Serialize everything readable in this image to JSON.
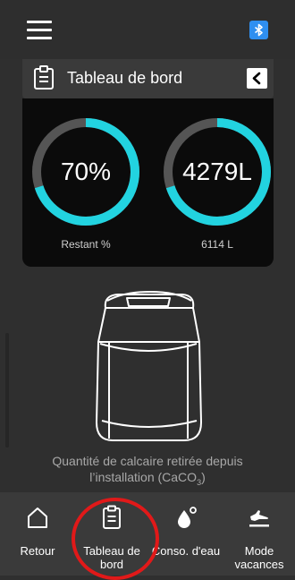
{
  "header": {
    "title": "Tableau de bord",
    "menu_icon": "hamburger-menu-icon",
    "bluetooth_icon": "bluetooth-icon",
    "back_icon": "chevron-left-icon"
  },
  "gauges": [
    {
      "value_label": "70%",
      "caption": "Restant %",
      "fill_fraction": 0.7
    },
    {
      "value_label": "4279L",
      "caption": "6114 L",
      "fill_fraction": 0.7
    }
  ],
  "device": {
    "icon": "water-softener-device-illustration"
  },
  "summary": {
    "text": "Quantité de calcaire retirée depuis",
    "line2": "l’installation (CaCO",
    "sub": "3",
    "close": ")"
  },
  "nav": [
    {
      "label": "Retour",
      "icon": "home-icon"
    },
    {
      "label": "Tableau de bord",
      "icon": "clipboard-icon",
      "active": true
    },
    {
      "label": "Conso. d'eau",
      "icon": "water-drop-icon"
    },
    {
      "label": "Mode vacances",
      "icon": "airplane-icon"
    }
  ],
  "colors": {
    "accent": "#22d3e0",
    "track": "#555555",
    "highlight": "#e11919",
    "bluetooth": "#2f8ff0"
  }
}
